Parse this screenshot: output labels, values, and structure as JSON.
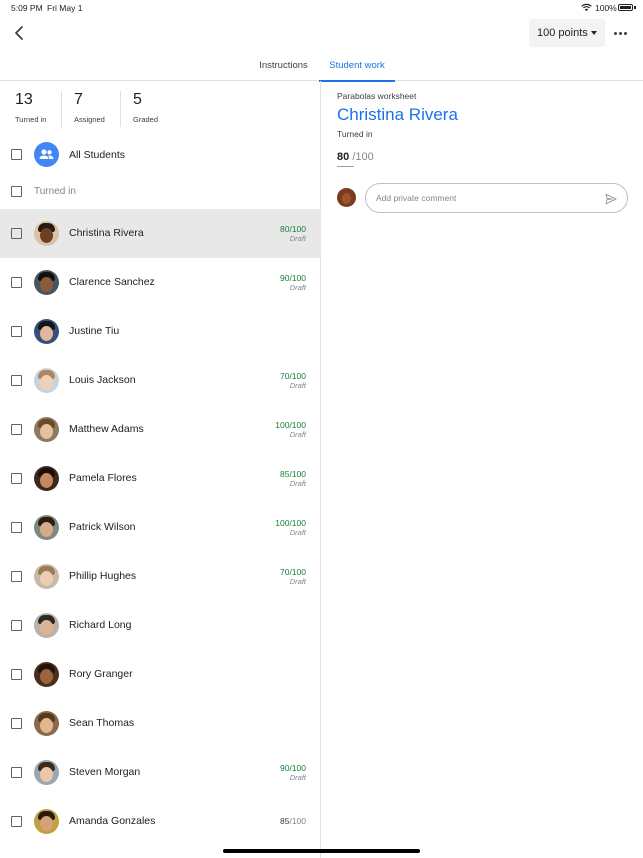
{
  "status_bar": {
    "time": "5:09 PM",
    "date": "Fri May 1",
    "battery": "100%"
  },
  "toolbar": {
    "points": "100 points"
  },
  "tabs": [
    {
      "label": "Instructions"
    },
    {
      "label": "Student work"
    }
  ],
  "stats": [
    {
      "value": "13",
      "label": "Turned in"
    },
    {
      "value": "7",
      "label": "Assigned"
    },
    {
      "value": "5",
      "label": "Graded"
    }
  ],
  "all_students": {
    "label": "All Students"
  },
  "turned_in_header": {
    "label": "Turned in"
  },
  "students": [
    {
      "name": "Christina Rivera",
      "score": "80/100",
      "status": "Draft",
      "selected": true
    },
    {
      "name": "Clarence Sanchez",
      "score": "90/100",
      "status": "Draft"
    },
    {
      "name": "Justine Tiu",
      "score": "",
      "status": ""
    },
    {
      "name": "Louis Jackson",
      "score": "70/100",
      "status": "Draft"
    },
    {
      "name": "Matthew Adams",
      "score": "100/100",
      "status": "Draft"
    },
    {
      "name": "Pamela Flores",
      "score": "85/100",
      "status": "Draft"
    },
    {
      "name": "Patrick Wilson",
      "score": "100/100",
      "status": "Draft"
    },
    {
      "name": "Phillip Hughes",
      "score": "70/100",
      "status": "Draft"
    },
    {
      "name": "Richard Long",
      "score": "",
      "status": ""
    },
    {
      "name": "Rory Granger",
      "score": "",
      "status": ""
    },
    {
      "name": "Sean Thomas",
      "score": "",
      "status": ""
    },
    {
      "name": "Steven Morgan",
      "score": "90/100",
      "status": "Draft"
    },
    {
      "name": "Amanda Gonzales",
      "score_num": "85",
      "score_denom": "/100"
    }
  ],
  "detail": {
    "assignment": "Parabolas worksheet",
    "student": "Christina Rivera",
    "status": "Turned in",
    "grade": "80",
    "grade_max": "/100",
    "comment_placeholder": "Add private comment"
  },
  "colors": {
    "accent": "#1a73e8",
    "draft_grade": "#188038",
    "selected_row": "#e8e8e8"
  },
  "icons": [
    "wifi-icon",
    "battery-icon",
    "back-arrow-icon",
    "caret-down-icon",
    "more-icon",
    "people-icon",
    "send-icon"
  ]
}
